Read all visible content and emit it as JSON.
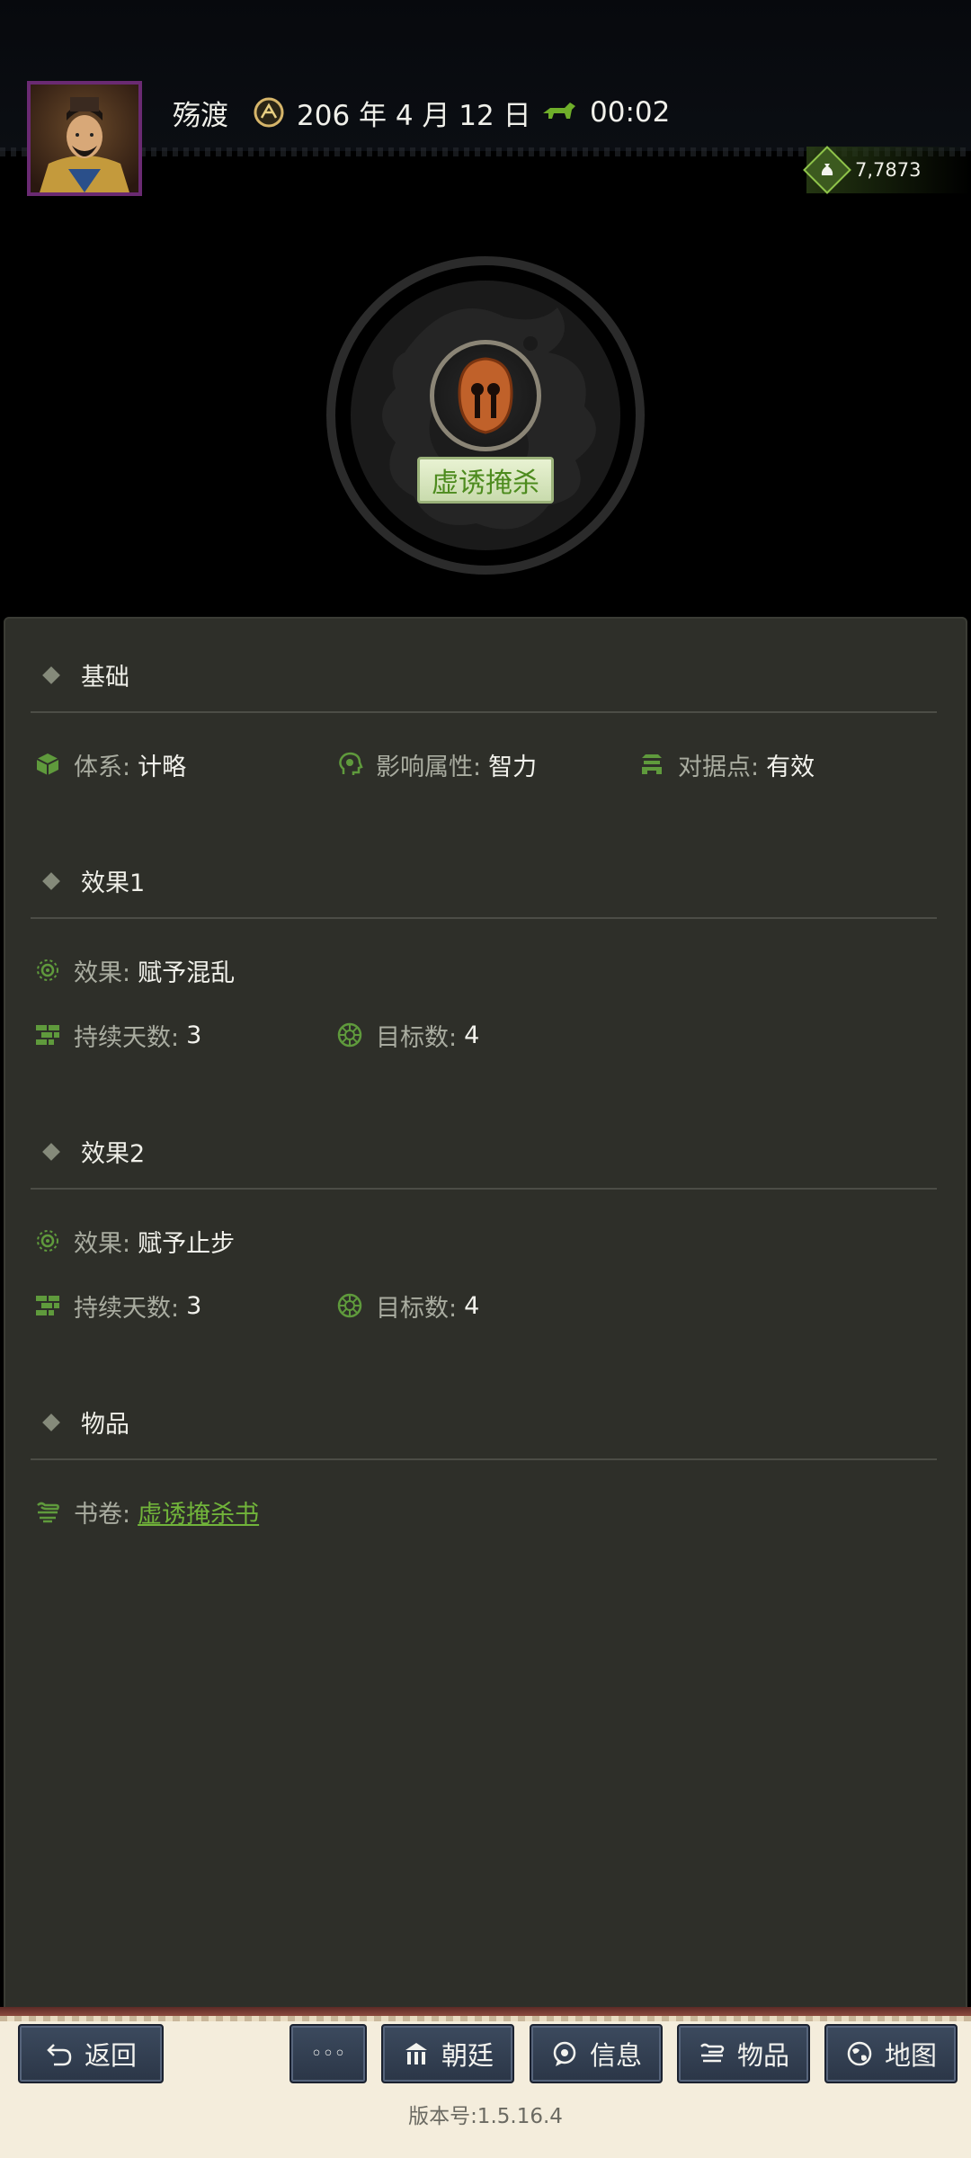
{
  "header": {
    "place": "殇渡",
    "date": "206 年 4 月 12 日",
    "time": "00:02",
    "gold": "7,7873"
  },
  "skill": {
    "name": "虚诱掩杀"
  },
  "sections": {
    "basic": {
      "title": "基础",
      "system_label": "体系:",
      "system_value": "计略",
      "attr_label": "影响属性:",
      "attr_value": "智力",
      "stronghold_label": "对据点:",
      "stronghold_value": "有效"
    },
    "effect1": {
      "title": "效果1",
      "effect_label": "效果:",
      "effect_value": "赋予混乱",
      "days_label": "持续天数:",
      "days_value": "3",
      "targets_label": "目标数:",
      "targets_value": "4"
    },
    "effect2": {
      "title": "效果2",
      "effect_label": "效果:",
      "effect_value": "赋予止步",
      "days_label": "持续天数:",
      "days_value": "3",
      "targets_label": "目标数:",
      "targets_value": "4"
    },
    "items": {
      "title": "物品",
      "scroll_label": "书卷:",
      "scroll_value": "虚诱掩杀书"
    }
  },
  "bottom": {
    "back": "返回",
    "more": "◦◦◦",
    "court": "朝廷",
    "info": "信息",
    "items": "物品",
    "map": "地图",
    "version": "版本号:1.5.16.4"
  },
  "colors": {
    "panel_bg": "#2e2f29",
    "accent_green": "#71b43a",
    "button_blue": "#2f3a4c"
  },
  "icons": [
    "gear-round-icon",
    "horse-icon",
    "gold-bag-icon",
    "cube-icon",
    "head-icon",
    "gate-icon",
    "sun-icon",
    "bricks-icon",
    "target-icon",
    "scroll-icon",
    "back-arrow-icon",
    "palace-icon",
    "chat-icon",
    "globe-icon"
  ]
}
